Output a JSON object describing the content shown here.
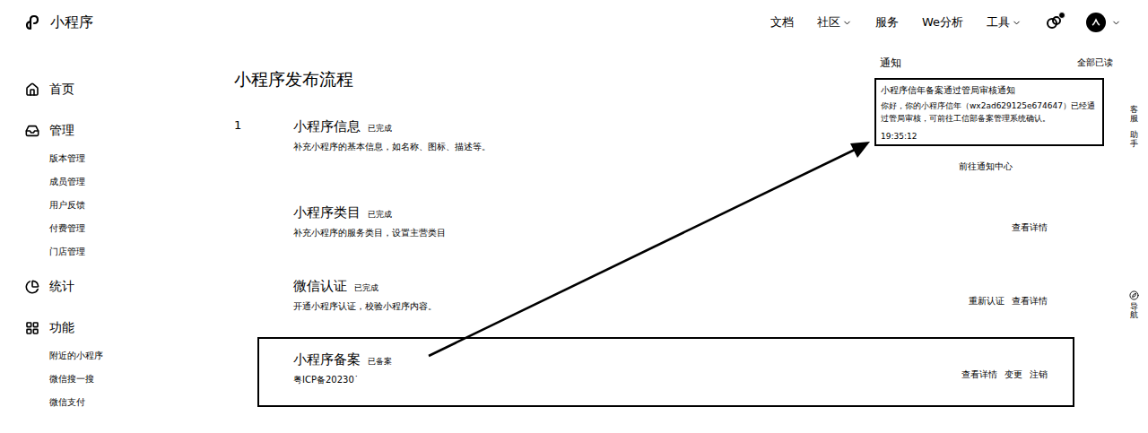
{
  "header": {
    "logo": "小程序",
    "nav": [
      {
        "label": "文档",
        "dropdown": false
      },
      {
        "label": "社区",
        "dropdown": true
      },
      {
        "label": "服务",
        "dropdown": false
      },
      {
        "label": "We分析",
        "dropdown": false
      },
      {
        "label": "工具",
        "dropdown": true
      }
    ],
    "has_unread": true
  },
  "sidebar": {
    "sections": [
      {
        "label": "首页",
        "icon": "home",
        "items": []
      },
      {
        "label": "管理",
        "icon": "manage",
        "items": [
          "版本管理",
          "成员管理",
          "用户反馈",
          "付费管理",
          "门店管理"
        ]
      },
      {
        "label": "统计",
        "icon": "stats",
        "items": []
      },
      {
        "label": "功能",
        "icon": "function",
        "items": [
          "附近的小程序",
          "微信搜一搜",
          "微信支付"
        ]
      }
    ]
  },
  "main": {
    "title": "小程序发布流程",
    "steps": [
      {
        "number": "1",
        "title": "小程序信息",
        "status": "已完成",
        "desc": "补充小程序的基本信息，如名称、图标、描述等。",
        "actions": [],
        "highlighted": false
      },
      {
        "number": "",
        "title": "小程序类目",
        "status": "已完成",
        "desc": "补充小程序的服务类目，设置主营类目",
        "actions": [
          "查看详情"
        ],
        "highlighted": false
      },
      {
        "number": "",
        "title": "微信认证",
        "status": "已完成",
        "desc": "开通小程序认证，校验小程序内容。",
        "actions": [
          "重新认证",
          "查看详情"
        ],
        "highlighted": false
      },
      {
        "number": "",
        "title": "小程序备案",
        "status": "已备案",
        "desc": "粤ICP备20230˙",
        "actions": [
          "查看详情",
          "变更",
          "注销"
        ],
        "highlighted": true
      }
    ]
  },
  "notifications": {
    "title": "通知",
    "mark_all": "全部已读",
    "items": [
      {
        "title": "小程序信年备案通过管局审核通知",
        "body": "你好，你的小程序信年（wx2ad629125e674647）已经通过管局审核，可前往工信部备案管理系统确认。",
        "time": "19:35:12",
        "highlighted": true
      }
    ],
    "footer": "前往通知中心"
  },
  "side_tools": [
    {
      "label": "客服"
    },
    {
      "label": "助手"
    },
    {
      "label": "导航"
    }
  ]
}
